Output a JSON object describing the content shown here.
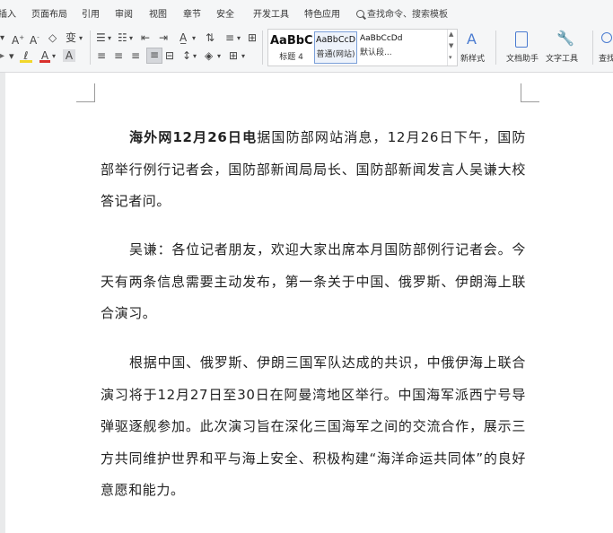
{
  "tabs": [
    "插入",
    "页面布局",
    "引用",
    "审阅",
    "视图",
    "章节",
    "安全",
    "开发工具",
    "特色应用"
  ],
  "search": "查找命令、搜索模板",
  "styles": [
    {
      "sample": "AaBbC",
      "name": "标题 4"
    },
    {
      "sample": "AaBbCcD",
      "name": "普通(网站)"
    },
    {
      "sample": "AaBbCcDd",
      "name": "默认段..."
    }
  ],
  "buttons": {
    "new_style": "新样式",
    "doc_assistant": "文档助手",
    "text_tools": "文字工具",
    "find": "查找"
  },
  "document": {
    "p1_lead": "海外网12月26日电",
    "p1_body": "据国防部网站消息，12月26日下午，国防部举行例行记者会，国防部新闻局局长、国防部新闻发言人吴谦大校答记者问。",
    "p2": "吴谦：各位记者朋友，欢迎大家出席本月国防部例行记者会。今天有两条信息需要主动发布，第一条关于中国、俄罗斯、伊朗海上联合演习。",
    "p3": "根据中国、俄罗斯、伊朗三国军队达成的共识，中俄伊海上联合演习将于12月27日至30日在阿曼湾地区举行。中国海军派西宁号导弹驱逐舰参加。此次演习旨在深化三国海军之间的交流合作，展示三方共同维护世界和平与海上安全、积极构建“海洋命运共同体”的良好意愿和能力。"
  },
  "colors": {
    "accent": "#4a7bd0",
    "font_red": "#d9302c"
  }
}
